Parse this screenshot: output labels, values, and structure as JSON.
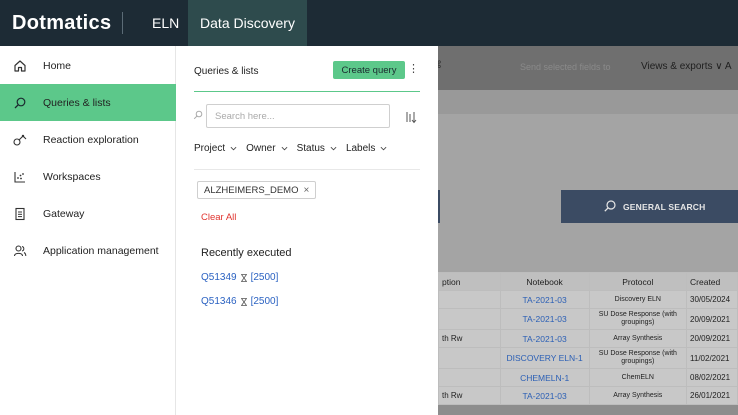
{
  "topbar": {
    "logo_text": "Dotmatics",
    "eln_label": "ELN",
    "active_tab": "Data Discovery"
  },
  "sidebar": {
    "items": [
      {
        "label": "Home",
        "icon": "home-icon"
      },
      {
        "label": "Queries & lists",
        "icon": "search-icon",
        "active": true
      },
      {
        "label": "Reaction exploration",
        "icon": "reaction-icon"
      },
      {
        "label": "Workspaces",
        "icon": "scatter-chart-icon"
      },
      {
        "label": "Gateway",
        "icon": "document-icon"
      },
      {
        "label": "Application management",
        "icon": "users-icon"
      }
    ]
  },
  "panel": {
    "title": "Queries & lists",
    "create_label": "Create query",
    "search_placeholder": "Search here...",
    "filters": [
      "Project",
      "Owner",
      "Status",
      "Labels"
    ],
    "chip_label": "ALZHEIMERS_DEMO",
    "clear_all_label": "Clear All",
    "recent_title": "Recently executed",
    "recent": [
      {
        "id": "Q51349",
        "count": "[2500]"
      },
      {
        "id": "Q51346",
        "count": "[2500]"
      }
    ]
  },
  "background": {
    "send_text": "Send selected fields to",
    "views_text": "Views & exports",
    "views_suffix": "A",
    "general_search_label": "GENERAL SEARCH",
    "table": {
      "headers": [
        "ption",
        "Notebook",
        "Protocol",
        "Created"
      ],
      "rows": [
        {
          "c0": "",
          "notebook": "TA-2021-03",
          "protocol": "Discovery ELN",
          "created": "30/05/2024"
        },
        {
          "c0": "",
          "notebook": "TA-2021-03",
          "protocol": "SU Dose Response (with groupings)",
          "created": "20/09/2021"
        },
        {
          "c0": "th Rw",
          "notebook": "TA-2021-03",
          "protocol": "Array Synthesis",
          "created": "20/09/2021"
        },
        {
          "c0": "",
          "notebook": "DISCOVERY ELN-1",
          "protocol": "SU Dose Response (with groupings)",
          "created": "11/02/2021"
        },
        {
          "c0": "",
          "notebook": "CHEMELN-1",
          "protocol": "ChemELN",
          "created": "08/02/2021"
        },
        {
          "c0": "th Rw",
          "notebook": "TA-2021-03",
          "protocol": "Array Synthesis",
          "created": "26/01/2021"
        }
      ]
    }
  },
  "colors": {
    "topbar": "#1d2b35",
    "active_tab": "#2e4b4d",
    "accent_green": "#5cc88a",
    "link_blue": "#2b62c2",
    "clear_red": "#e0342f"
  }
}
